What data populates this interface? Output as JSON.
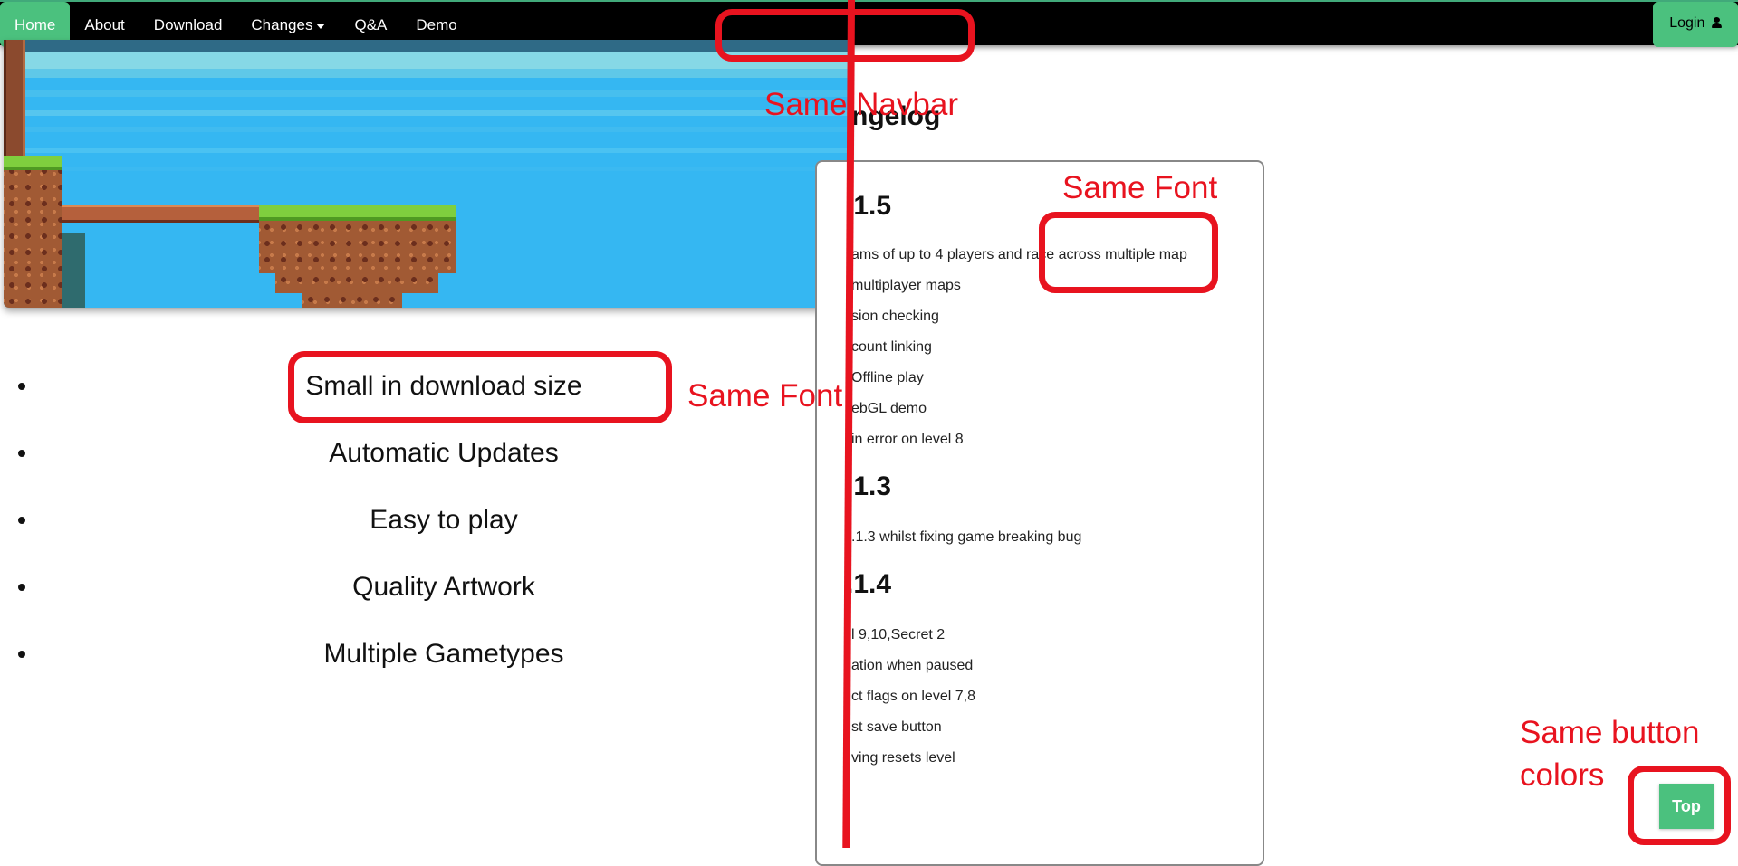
{
  "navbar": {
    "items": [
      {
        "label": "Home",
        "active": true
      },
      {
        "label": "About"
      },
      {
        "label": "Download"
      },
      {
        "label": "Changes",
        "has_dropdown": true
      },
      {
        "label": "Q&A"
      },
      {
        "label": "Demo"
      }
    ],
    "login_label": "Login"
  },
  "features": [
    "Small in download size",
    "Automatic Updates",
    "Easy to play",
    "Quality Artwork",
    "Multiple Gametypes"
  ],
  "changelog": {
    "heading_visible": "ngelog",
    "versions": [
      {
        "label": ".1.5",
        "entries": [
          "ams of up to 4 players and race across multiple map",
          "multiplayer maps",
          "sion checking",
          "count linking",
          "Offline play",
          "ebGL demo",
          "in error on level 8"
        ]
      },
      {
        "label": ".1.3",
        "entries": [
          ".1.3 whilst fixing game breaking bug"
        ]
      },
      {
        "label": ".1.4",
        "entries": [
          "l 9,10,Secret 2",
          "ation when paused",
          "ct flags on level 7,8",
          "st save button",
          "ving resets level"
        ]
      }
    ]
  },
  "top_button_label": "Top",
  "annotations": {
    "same_navbar": "Same   Navbar",
    "same_font_right": "Same Font",
    "same_font_left": "Same Font",
    "same_button_colors_line1": "Same button",
    "same_button_colors_line2": "colors"
  },
  "colors": {
    "accent_green": "#4bc17e",
    "navbar_bg": "#000000",
    "annotation_red": "#e8131f",
    "water": "#35b7f2"
  },
  "icons": {
    "login": "user-icon",
    "changes_dropdown": "caret-down-icon"
  }
}
